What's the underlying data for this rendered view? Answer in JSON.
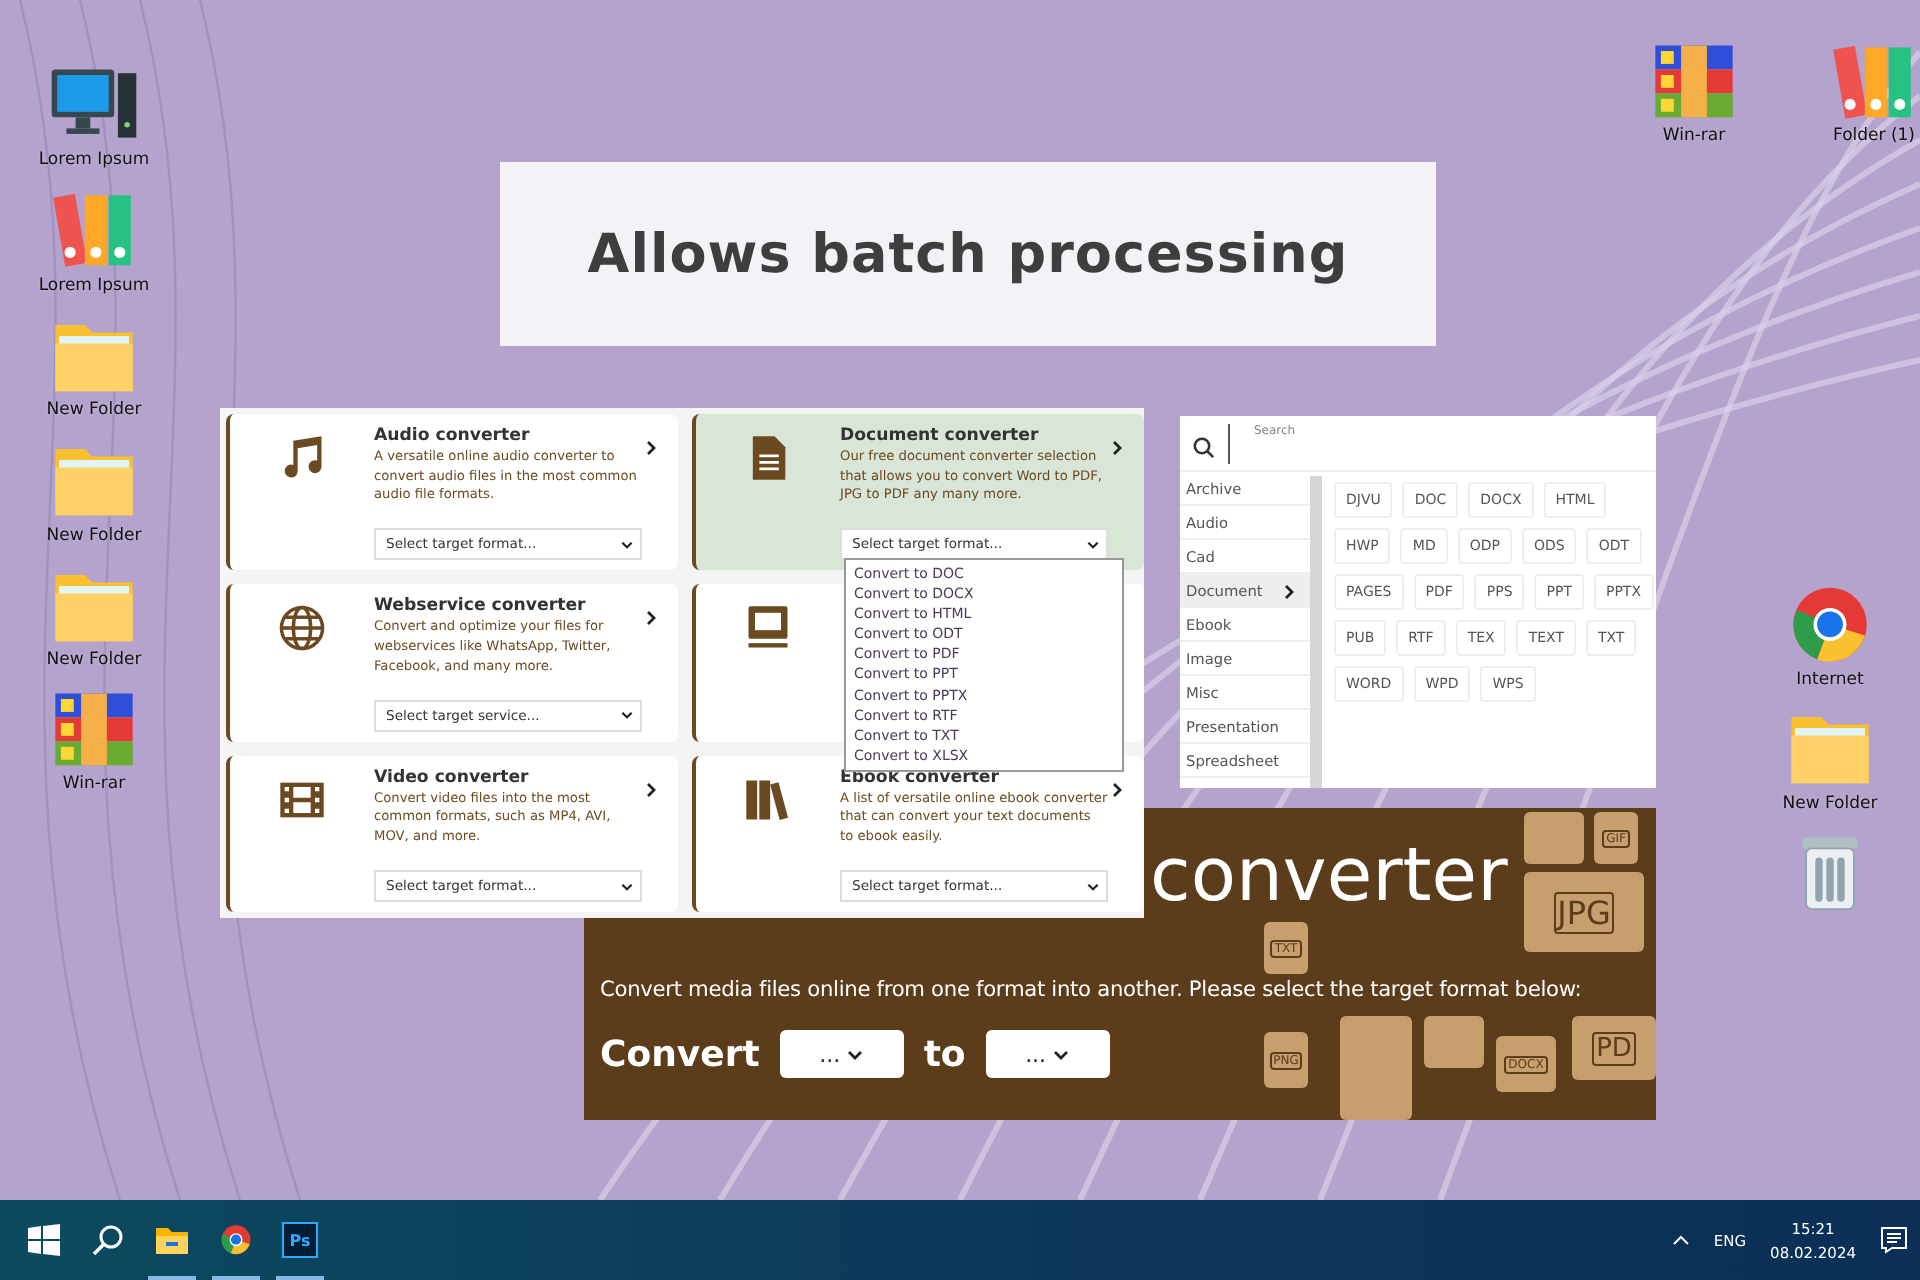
{
  "desktop": {
    "left_icons": [
      {
        "label": "Lorem Ipsum",
        "kind": "computer"
      },
      {
        "label": "Lorem Ipsum",
        "kind": "binders"
      },
      {
        "label": "New Folder",
        "kind": "folder"
      },
      {
        "label": "New Folder",
        "kind": "folder"
      },
      {
        "label": "New Folder",
        "kind": "folder"
      },
      {
        "label": "Win-rar",
        "kind": "archive"
      }
    ],
    "top_right_icons": [
      {
        "label": "Win-rar",
        "kind": "archive"
      },
      {
        "label": "Folder (1)",
        "kind": "binders"
      }
    ],
    "right_icons": [
      {
        "label": "Internet",
        "kind": "browser"
      },
      {
        "label": "New Folder",
        "kind": "folder"
      },
      {
        "kind": "trash"
      }
    ]
  },
  "headline": "Allows batch processing",
  "converter_panel": {
    "cards": [
      {
        "kind": "audio",
        "title": "Audio converter",
        "description": "A versatile online audio converter to convert audio files in the most common audio file formats.",
        "select": "Select target format...",
        "highlighted": false
      },
      {
        "kind": "document",
        "title": "Document converter",
        "description": "Our free document converter selection that allows you to convert Word to PDF, JPG to PDF any many more.",
        "select": "Select target format...",
        "highlighted": true,
        "options": [
          "Convert to DOC",
          "Convert to DOCX",
          "Convert to HTML",
          "Convert to ODT",
          "Convert to PDF",
          "Convert to PPT",
          "Convert to PPTX",
          "Convert to RTF",
          "Convert to TXT",
          "Convert to XLSX"
        ]
      },
      {
        "kind": "web",
        "title": "Webservice converter",
        "description": "Convert and optimize your files for webservices like WhatsApp, Twitter, Facebook, and many more.",
        "select": "Select target service...",
        "highlighted": false
      },
      {
        "kind": "computer",
        "highlighted": false
      },
      {
        "kind": "video",
        "title": "Video converter",
        "description": "Convert video files into the most common formats, such as MP4, AVI, MOV, and more.",
        "select": "Select target format...",
        "highlighted": false
      },
      {
        "kind": "ebook",
        "title": "Ebook converter",
        "description": "A list of versatile online ebook converter that can convert your text documents to ebook easily.",
        "select": "Select target format...",
        "highlighted": false
      }
    ]
  },
  "format_picker": {
    "search_placeholder": "Search",
    "categories": [
      {
        "label": "Archive",
        "selected": false
      },
      {
        "label": "Audio",
        "selected": false
      },
      {
        "label": "Cad",
        "selected": false
      },
      {
        "label": "Document",
        "selected": true
      },
      {
        "label": "Ebook",
        "selected": false
      },
      {
        "label": "Image",
        "selected": false
      },
      {
        "label": "Misc",
        "selected": false
      },
      {
        "label": "Presentation",
        "selected": false
      },
      {
        "label": "Spreadsheet",
        "selected": false
      }
    ],
    "format_rows": [
      [
        "DJVU",
        "DOC",
        "DOCX",
        "HTML"
      ],
      [
        "HWP",
        "MD",
        "ODP",
        "ODS",
        "ODT"
      ],
      [
        "PAGES",
        "PDF",
        "PPS",
        "PPT",
        "PPTX"
      ],
      [
        "PUB",
        "RTF",
        "TEX",
        "TEXT",
        "TXT"
      ],
      [
        "WORD",
        "WPD",
        "WPS"
      ]
    ]
  },
  "banner": {
    "heading": "converter",
    "description": "Convert media files online from one format into another. Please select the target format below:",
    "convert_label": "Convert",
    "from_value": "...",
    "to_label": "to",
    "to_value": "...",
    "file_badges": [
      "GIF",
      "JPG",
      "TXT",
      "PD",
      "PNG",
      "DOCX"
    ]
  },
  "taskbar": {
    "apps": [
      {
        "kind": "explorer",
        "open": true
      },
      {
        "kind": "browser",
        "open": true
      },
      {
        "kind": "editor",
        "open": true,
        "label": "Ps"
      }
    ],
    "language": "ENG",
    "time": "15:21",
    "date": "08.02.2024"
  }
}
